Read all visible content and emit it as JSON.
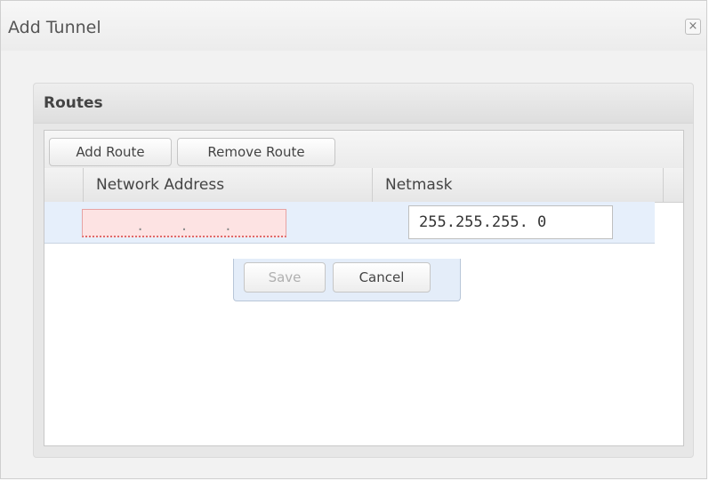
{
  "dialog": {
    "title": "Add Tunnel",
    "close_icon": "×"
  },
  "routes": {
    "title": "Routes",
    "toolbar": {
      "add_label": "Add Route",
      "remove_label": "Remove Route"
    },
    "columns": [
      "Network Address",
      "Netmask"
    ],
    "editing_row": {
      "network_address_separator": ".",
      "netmask_value": "255.255.255. 0"
    }
  },
  "editor": {
    "save_label": "Save",
    "cancel_label": "Cancel"
  },
  "colors": {
    "invalid_field": "#fde3e3",
    "selected_row": "#e6effb",
    "disabled_text": "#b0b0b0"
  }
}
